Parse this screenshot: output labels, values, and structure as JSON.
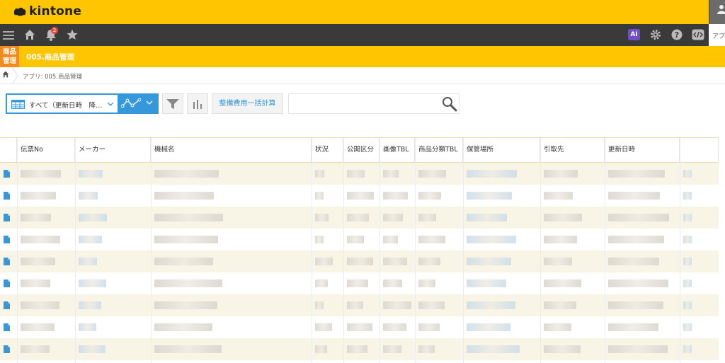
{
  "header": {
    "logo_text": "kintone"
  },
  "navbar": {
    "notification_count": "2",
    "ai_label": "AI",
    "apps_tab_label": "アプリ"
  },
  "app": {
    "icon_line1": "商品",
    "icon_line2": "管理",
    "title": "005.商品管理"
  },
  "breadcrumb": {
    "text": "アプリ: 005.商品管理"
  },
  "toolbar": {
    "view_label": "すべて（更新日時　降…",
    "calc_button": "整備費用一括計算",
    "search_placeholder": ""
  },
  "table": {
    "columns": [
      "伝票No",
      "メーカー",
      "機械名",
      "状況",
      "公開区分",
      "画像TBL",
      "商品分類TBL",
      "保管場所",
      "引取先",
      "更新日時"
    ],
    "row_count": 9
  },
  "colors": {
    "brand_yellow": "#ffc600",
    "nav_dark": "#3a3a3a",
    "accent_blue": "#3498db",
    "app_icon_orange": "#f28b1b",
    "row_stripe": "#f9f5e6"
  }
}
